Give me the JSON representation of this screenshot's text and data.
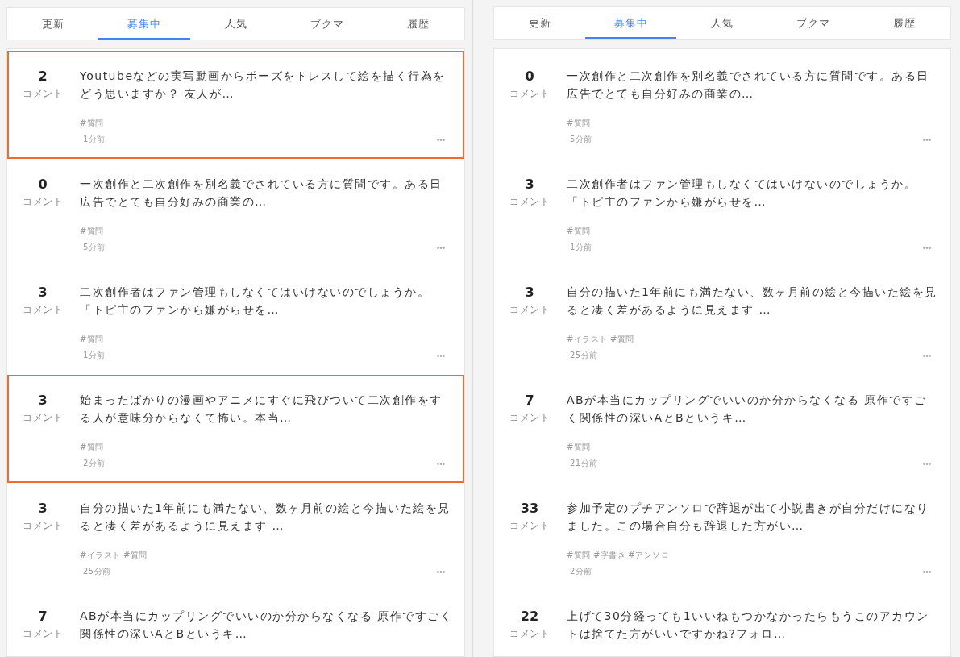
{
  "panes": [
    {
      "tabs": [
        {
          "label": "更新",
          "selected": false
        },
        {
          "label": "募集中",
          "selected": true
        },
        {
          "label": "人気",
          "selected": false
        },
        {
          "label": "ブクマ",
          "selected": false
        },
        {
          "label": "履歴",
          "selected": false
        }
      ],
      "posts": [
        {
          "comments": "2",
          "comment_label": "コメント",
          "title": "Youtubeなどの実写動画からポーズをトレスして絵を描く行為をどう思いますか？ 友人が…",
          "tags": [
            "#質問"
          ],
          "time": "1分前",
          "highlighted": true
        },
        {
          "comments": "0",
          "comment_label": "コメント",
          "title": "一次創作と二次創作を別名義でされている方に質問です。ある日広告でとても自分好みの商業の…",
          "tags": [
            "#質問"
          ],
          "time": "5分前",
          "highlighted": false
        },
        {
          "comments": "3",
          "comment_label": "コメント",
          "title": "二次創作者はファン管理もしなくてはいけないのでしょうか。「トピ主のファンから嫌がらせを…",
          "tags": [
            "#質問"
          ],
          "time": "1分前",
          "highlighted": false
        },
        {
          "comments": "3",
          "comment_label": "コメント",
          "title": "始まったばかりの漫画やアニメにすぐに飛びついて二次創作をする人が意味分からなくて怖い。本当…",
          "tags": [
            "#質問"
          ],
          "time": "2分前",
          "highlighted": true
        },
        {
          "comments": "3",
          "comment_label": "コメント",
          "title": "自分の描いた1年前にも満たない、数ヶ月前の絵と今描いた絵を見ると凄く差があるように見えます …",
          "tags": [
            "#イラスト",
            "#質問"
          ],
          "time": "25分前",
          "highlighted": false
        },
        {
          "comments": "7",
          "comment_label": "コメント",
          "title": "ABが本当にカップリングでいいのか分からなくなる 原作ですごく関係性の深いAとBというキ…",
          "highlighted": false
        }
      ]
    },
    {
      "tabs": [
        {
          "label": "更新",
          "selected": false
        },
        {
          "label": "募集中",
          "selected": true
        },
        {
          "label": "人気",
          "selected": false
        },
        {
          "label": "ブクマ",
          "selected": false
        },
        {
          "label": "履歴",
          "selected": false
        }
      ],
      "posts": [
        {
          "comments": "0",
          "comment_label": "コメント",
          "title": "一次創作と二次創作を別名義でされている方に質問です。ある日広告でとても自分好みの商業の…",
          "tags": [
            "#質問"
          ],
          "time": "5分前",
          "highlighted": false
        },
        {
          "comments": "3",
          "comment_label": "コメント",
          "title": "二次創作者はファン管理もしなくてはいけないのでしょうか。「トピ主のファンから嫌がらせを…",
          "tags": [
            "#質問"
          ],
          "time": "1分前",
          "highlighted": false
        },
        {
          "comments": "3",
          "comment_label": "コメント",
          "title": "自分の描いた1年前にも満たない、数ヶ月前の絵と今描いた絵を見ると凄く差があるように見えます …",
          "tags": [
            "#イラスト",
            "#質問"
          ],
          "time": "25分前",
          "highlighted": false
        },
        {
          "comments": "7",
          "comment_label": "コメント",
          "title": "ABが本当にカップリングでいいのか分からなくなる 原作ですごく関係性の深いAとBというキ…",
          "tags": [
            "#質問"
          ],
          "time": "21分前",
          "highlighted": false
        },
        {
          "comments": "33",
          "comment_label": "コメント",
          "title": "参加予定のプチアンソロで辞退が出て小説書きが自分だけになりました。この場合自分も辞退した方がい…",
          "tags": [
            "#質問",
            "#字書き",
            "#アンソロ"
          ],
          "time": "2分前",
          "highlighted": false
        },
        {
          "comments": "22",
          "comment_label": "コメント",
          "title": "上げて30分経っても1いいねもつかなかったらもうこのアカウントは捨てた方がいいですかね?フォロ…",
          "highlighted": false
        }
      ]
    }
  ]
}
